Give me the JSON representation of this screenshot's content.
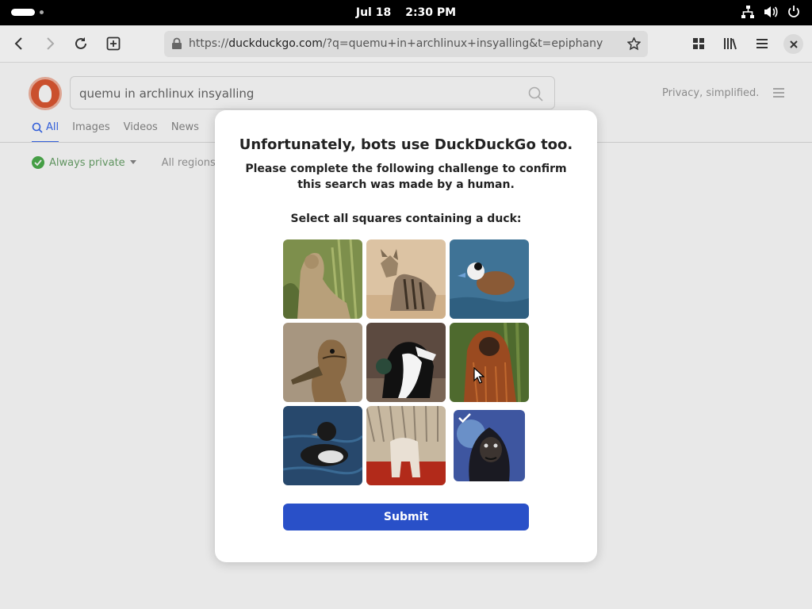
{
  "topbar": {
    "date": "Jul 18",
    "time": "2:30 PM",
    "icons": [
      "network-icon",
      "volume-icon",
      "power-icon"
    ]
  },
  "browser": {
    "url_prefix": "https://",
    "url_domain": "duckduckgo.com",
    "url_rest": "/?q=quemu+in+archlinux+insyalling&t=epiphany",
    "icons": [
      "back-icon",
      "forward-icon",
      "reload-icon",
      "new-tab-icon",
      "lock-icon",
      "bookmark-star-icon",
      "tabs-overview-icon",
      "library-icon",
      "hamburger-menu-icon",
      "close-icon"
    ]
  },
  "page": {
    "search_query": "quemu in archlinux insyalling",
    "tagline": "Privacy, simplified.",
    "tabs": [
      {
        "label": "All"
      },
      {
        "label": "Images"
      },
      {
        "label": "Videos"
      },
      {
        "label": "News"
      }
    ],
    "privacy_filter": "Always private",
    "region_filter": "All regions"
  },
  "challenge": {
    "title": "Unfortunately, bots use DuckDuckGo too.",
    "subtitle": "Please complete the following challenge to confirm this search was made by a human.",
    "prompt": "Select all squares containing a duck:",
    "submit_label": "Submit",
    "tiles": [
      {
        "subject": "lynx",
        "selected": false
      },
      {
        "subject": "aardwolf",
        "selected": false
      },
      {
        "subject": "duck",
        "selected": false
      },
      {
        "subject": "duck",
        "selected": false
      },
      {
        "subject": "dog",
        "selected": false
      },
      {
        "subject": "orangutan",
        "selected": false
      },
      {
        "subject": "duck",
        "selected": false
      },
      {
        "subject": "dog",
        "selected": false
      },
      {
        "subject": "gorilla",
        "selected": true
      }
    ]
  },
  "colors": {
    "accent": "#3969ef",
    "submit_bg": "#2950c8",
    "ddg_orange": "#de5833"
  }
}
